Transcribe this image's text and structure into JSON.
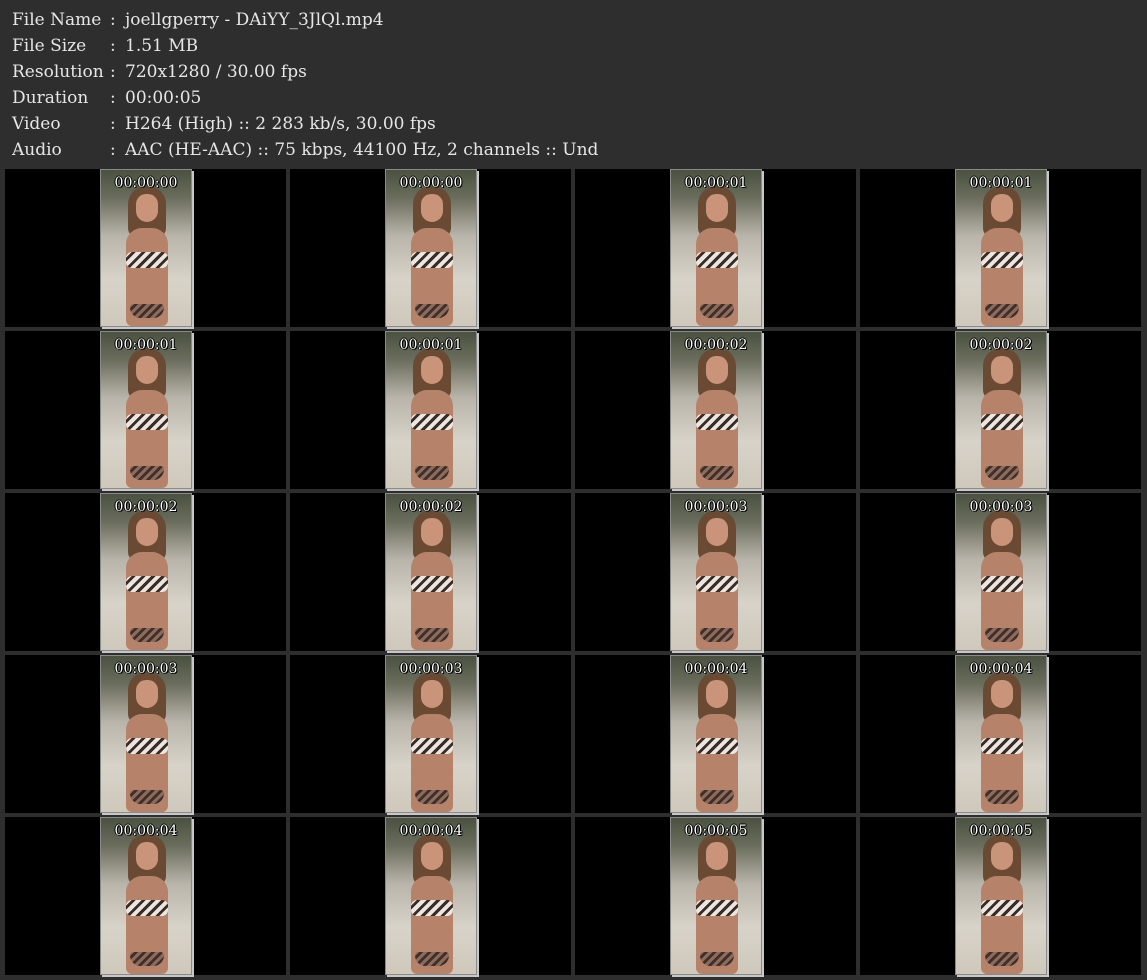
{
  "metadata": [
    {
      "key": "File Name",
      "sep": ":",
      "value": "joellgperry - DAiYY_3JlQl.mp4"
    },
    {
      "key": "File Size",
      "sep": ":",
      "value": "1.51 MB"
    },
    {
      "key": "Resolution",
      "sep": ":",
      "value": "720x1280 / 30.00 fps"
    },
    {
      "key": "Duration",
      "sep": ":",
      "value": "00:00:05"
    },
    {
      "key": "Video",
      "sep": ":",
      "value": "H264 (High) :: 2 283 kb/s, 30.00 fps"
    },
    {
      "key": "Audio",
      "sep": ":",
      "value": "AAC (HE-AAC) :: 75 kbps, 44100 Hz, 2 channels :: Und"
    }
  ],
  "thumbnails": [
    {
      "time": "00:00:00"
    },
    {
      "time": "00:00:00"
    },
    {
      "time": "00:00:01"
    },
    {
      "time": "00:00:01"
    },
    {
      "time": "00:00:01"
    },
    {
      "time": "00:00:01"
    },
    {
      "time": "00:00:02"
    },
    {
      "time": "00:00:02"
    },
    {
      "time": "00:00:02"
    },
    {
      "time": "00:00:02"
    },
    {
      "time": "00:00:03"
    },
    {
      "time": "00:00:03"
    },
    {
      "time": "00:00:03"
    },
    {
      "time": "00:00:03"
    },
    {
      "time": "00:00:04"
    },
    {
      "time": "00:00:04"
    },
    {
      "time": "00:00:04"
    },
    {
      "time": "00:00:04"
    },
    {
      "time": "00:00:05"
    },
    {
      "time": "00:00:05"
    }
  ]
}
